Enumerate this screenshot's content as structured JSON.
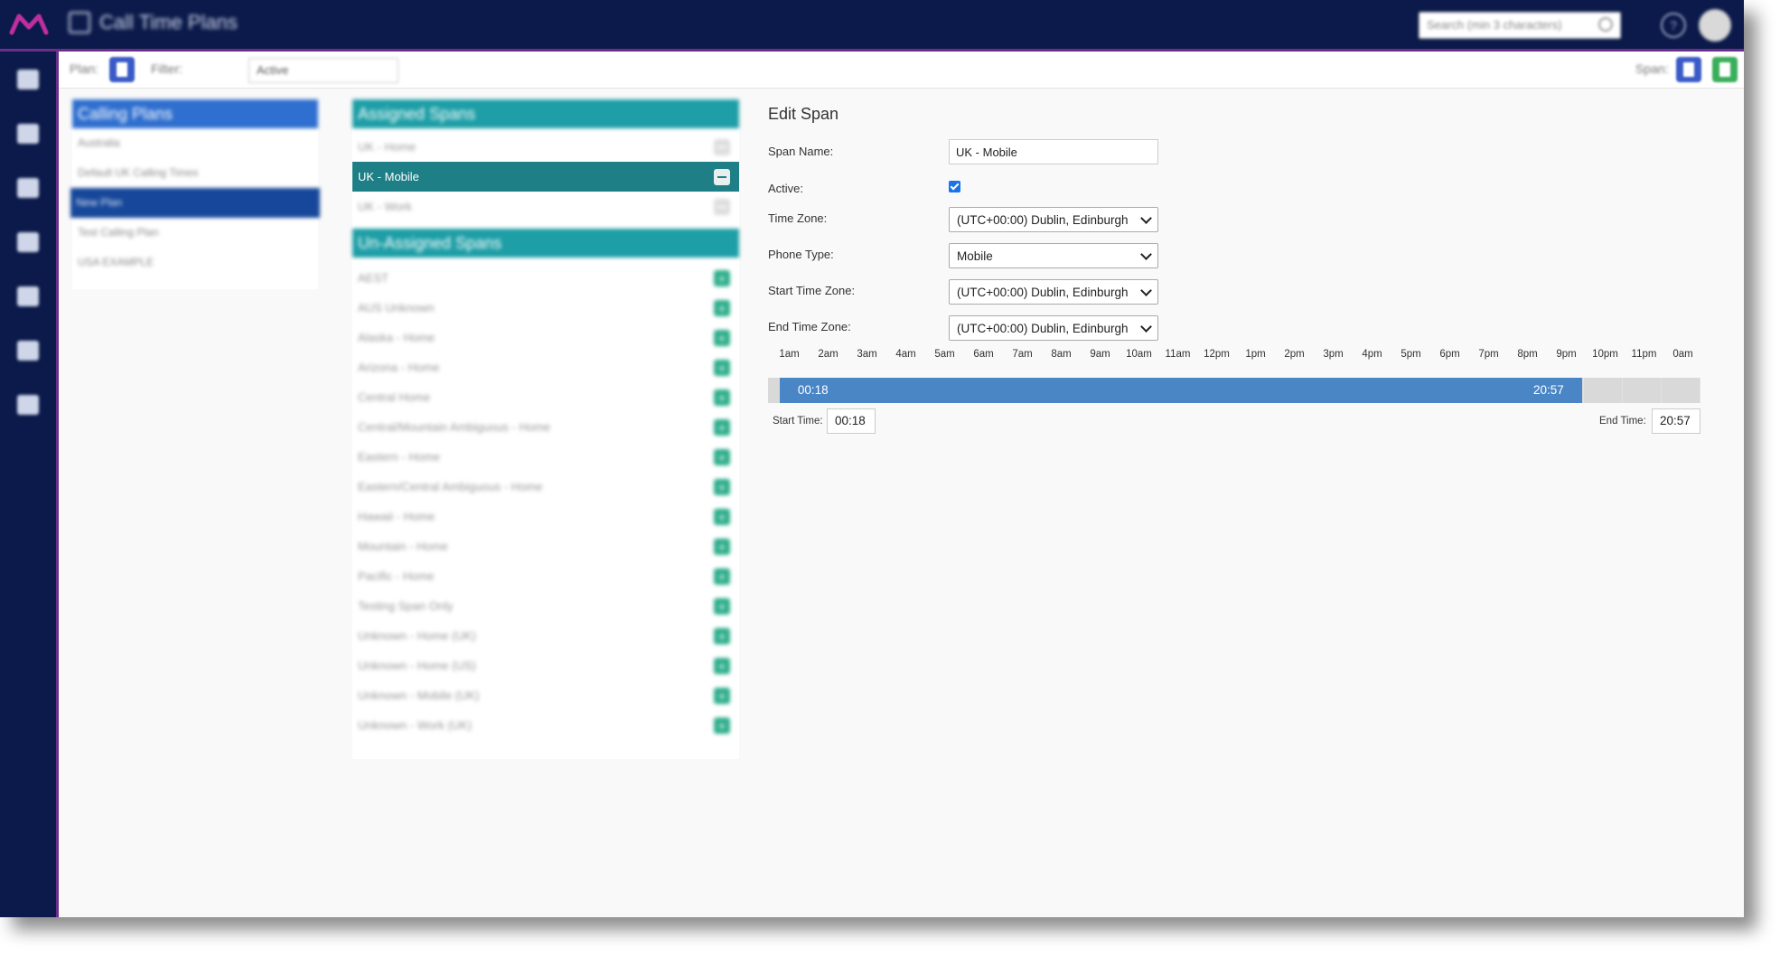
{
  "app": {
    "title": "Call Time Plans"
  },
  "search": {
    "placeholder": "Search (min 3 characters)"
  },
  "toolbar": {
    "plan_label": "Plan:",
    "filter_label": "Filter:",
    "filter_value": "Active",
    "span_label": "Span:"
  },
  "calling_plans": {
    "title": "Calling Plans",
    "items": [
      "Australia",
      "Default UK Calling Times",
      "New Plan",
      "Test Calling Plan",
      "USA EXAMPLE"
    ],
    "selected_index": 2
  },
  "assigned_spans": {
    "title": "Assigned Spans",
    "items": [
      "UK - Home",
      "UK - Mobile",
      "UK - Work"
    ],
    "selected_index": 1
  },
  "unassigned_spans": {
    "title": "Un-Assigned Spans",
    "items": [
      "AEST",
      "AUS Unknown",
      "Alaska - Home",
      "Arizona - Home",
      "Central Home",
      "Central/Mountain Ambiguous - Home",
      "Eastern - Home",
      "Eastern/Central Ambiguous - Home",
      "Hawaii - Home",
      "Mountain - Home",
      "Pacific - Home",
      "Testing Span Only",
      "Unknown - Home (UK)",
      "Unknown - Home (US)",
      "Unknown - Mobile (UK)",
      "Unknown - Work (UK)"
    ]
  },
  "edit_span": {
    "title": "Edit Span",
    "span_name_label": "Span Name:",
    "span_name": "UK - Mobile",
    "active_label": "Active:",
    "active": true,
    "time_zone_label": "Time Zone:",
    "time_zone": "(UTC+00:00) Dublin, Edinburgh",
    "phone_type_label": "Phone Type:",
    "phone_type": "Mobile",
    "start_tz_label": "Start Time Zone:",
    "start_tz": "(UTC+00:00) Dublin, Edinburgh",
    "end_tz_label": "End Time Zone:",
    "end_tz": "(UTC+00:00) Dublin, Edinburgh"
  },
  "timeline": {
    "hours": [
      "1am",
      "2am",
      "3am",
      "4am",
      "5am",
      "6am",
      "7am",
      "8am",
      "9am",
      "10am",
      "11am",
      "12pm",
      "1pm",
      "2pm",
      "3pm",
      "4pm",
      "5pm",
      "6pm",
      "7pm",
      "8pm",
      "9pm",
      "10pm",
      "11pm",
      "0am"
    ],
    "start_time_label": "Start Time:",
    "start_time": "00:18",
    "end_time_label": "End Time:",
    "end_time": "20:57",
    "start_hours": 0.3,
    "end_hours": 20.95
  },
  "colors": {
    "nav": "#0b1a4a",
    "accent_purple": "#6b2f8a",
    "plans_header": "#2f6fcf",
    "spans_header": "#1e9ea6",
    "selected_span": "#1e7f86",
    "timeline_fill": "#4a86c6",
    "add_green": "#2fae8c"
  }
}
